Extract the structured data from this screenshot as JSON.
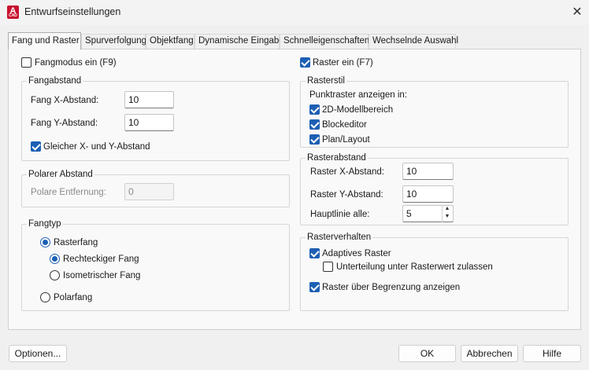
{
  "window": {
    "title": "Entwurfseinstellungen",
    "app_icon_letter": "A",
    "app_icon_sub": "CAD"
  },
  "tabs": [
    {
      "label": "Fang und Raster",
      "active": true
    },
    {
      "label": "Spurverfolgung"
    },
    {
      "label": "Objektfang"
    },
    {
      "label": "Dynamische Eingabe"
    },
    {
      "label": "Schnelleigenschaften"
    },
    {
      "label": "Wechselnde Auswahl"
    }
  ],
  "snap": {
    "enable_label": "Fangmodus ein (F9)",
    "enable_checked": false,
    "spacing_title": "Fangabstand",
    "x_label": "Fang X-Abstand:",
    "x_value": "10",
    "y_label": "Fang Y-Abstand:",
    "y_value": "10",
    "equal_label": "Gleicher X- und Y-Abstand",
    "equal_checked": true,
    "polar_title": "Polarer Abstand",
    "polar_label": "Polare Entfernung:",
    "polar_value": "0",
    "type_title": "Fangtyp",
    "grid_snap_label": "Rasterfang",
    "rect_label": "Rechteckiger Fang",
    "iso_label": "Isometrischer Fang",
    "polar_snap_label": "Polarfang"
  },
  "grid": {
    "enable_label": "Raster ein (F7)",
    "enable_checked": true,
    "style_title": "Rasterstil",
    "style_caption": "Punktraster anzeigen in:",
    "model_label": "2D-Modellbereich",
    "block_label": "Blockeditor",
    "sheet_label": "Plan/Layout",
    "spacing_title": "Rasterabstand",
    "x_label": "Raster X-Abstand:",
    "x_value": "10",
    "y_label": "Raster Y-Abstand:",
    "y_value": "10",
    "major_label": "Hauptlinie alle:",
    "major_value": "5",
    "behavior_title": "Rasterverhalten",
    "adaptive_label": "Adaptives Raster",
    "subdiv_label": "Unterteilung unter Rasterwert zulassen",
    "beyond_label": "Raster über Begrenzung anzeigen"
  },
  "buttons": {
    "options": "Optionen...",
    "ok": "OK",
    "cancel": "Abbrechen",
    "help": "Hilfe"
  }
}
